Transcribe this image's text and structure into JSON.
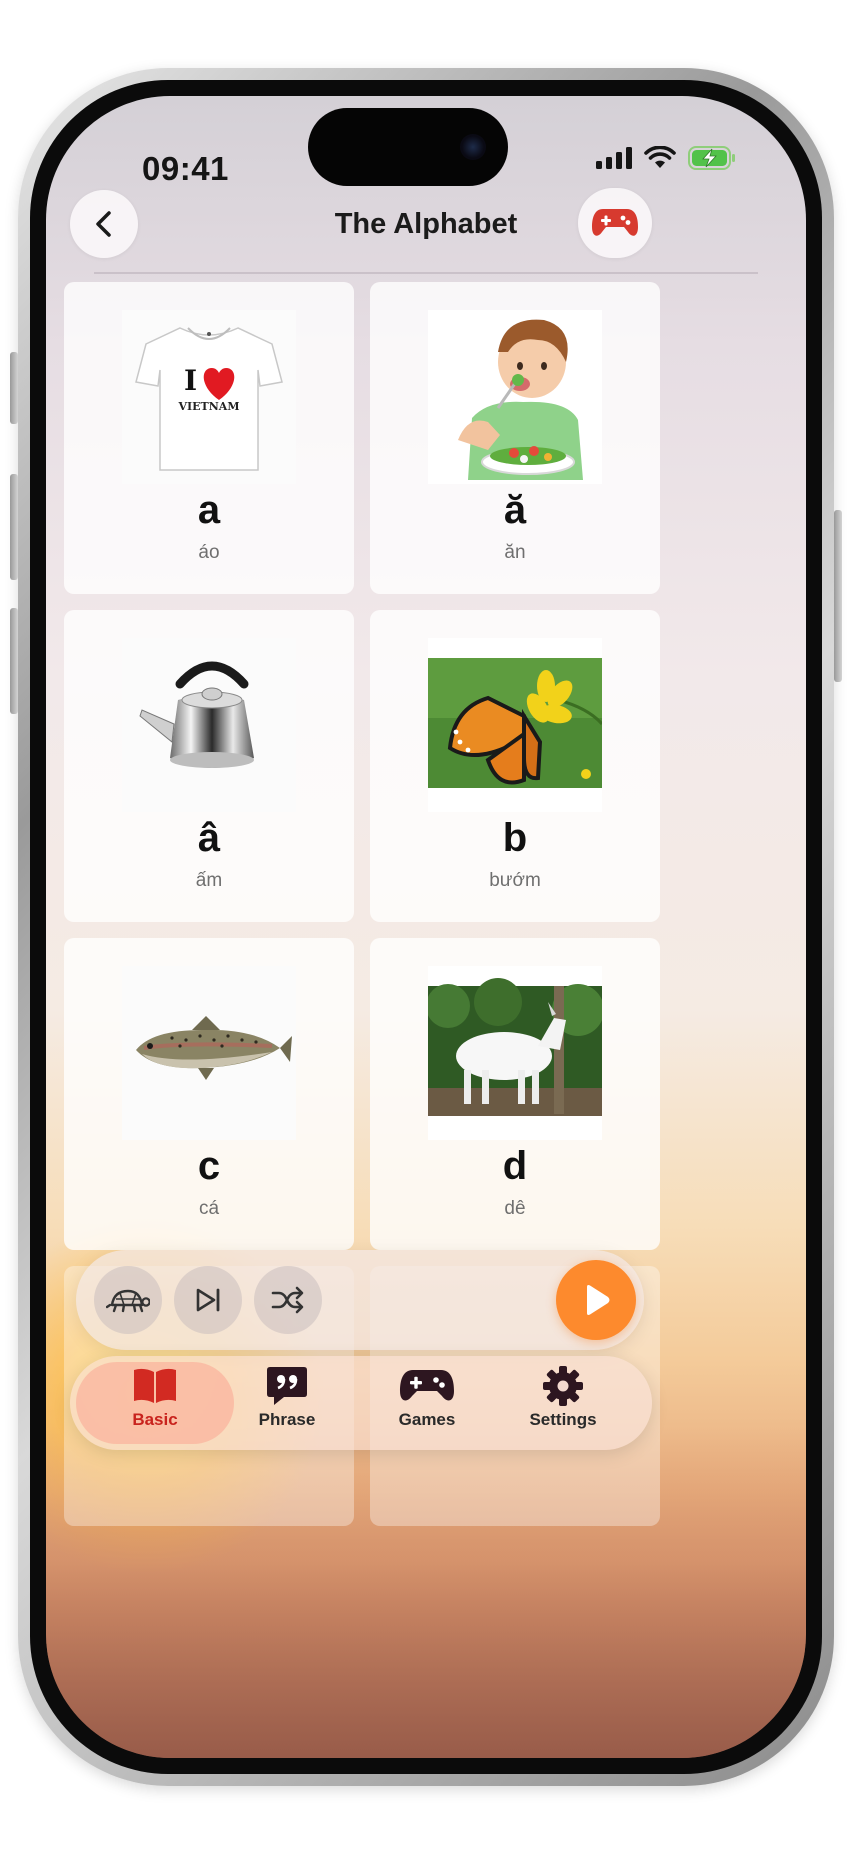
{
  "status_bar": {
    "time": "09:41"
  },
  "header": {
    "title": "The Alphabet"
  },
  "cards": [
    {
      "letter": "a",
      "word": "áo",
      "image": "t-shirt-i-love-vietnam"
    },
    {
      "letter": "ă",
      "word": "ăn",
      "image": "boy-eating-salad"
    },
    {
      "letter": "â",
      "word": "ấm",
      "image": "kettle"
    },
    {
      "letter": "b",
      "word": "bướm",
      "image": "butterfly-on-flower"
    },
    {
      "letter": "c",
      "word": "cá",
      "image": "fish"
    },
    {
      "letter": "d",
      "word": "dê",
      "image": "goat"
    }
  ],
  "tshirt_text": {
    "line1": "I",
    "line2": "VIETNAM"
  },
  "player": {
    "controls": [
      "turtle-slow-icon",
      "skip-next-icon",
      "shuffle-icon",
      "play-icon"
    ]
  },
  "tabs": [
    {
      "label": "Basic",
      "icon": "book-icon",
      "active": true
    },
    {
      "label": "Phrase",
      "icon": "quote-bubble-icon",
      "active": false
    },
    {
      "label": "Games",
      "icon": "gamepad-icon",
      "active": false
    },
    {
      "label": "Settings",
      "icon": "gear-icon",
      "active": false
    }
  ],
  "colors": {
    "accent": "#fd8a2d",
    "active_tab": "#c8231d",
    "dark_icon": "#2d1620",
    "game_icon": "#d73a2f"
  }
}
